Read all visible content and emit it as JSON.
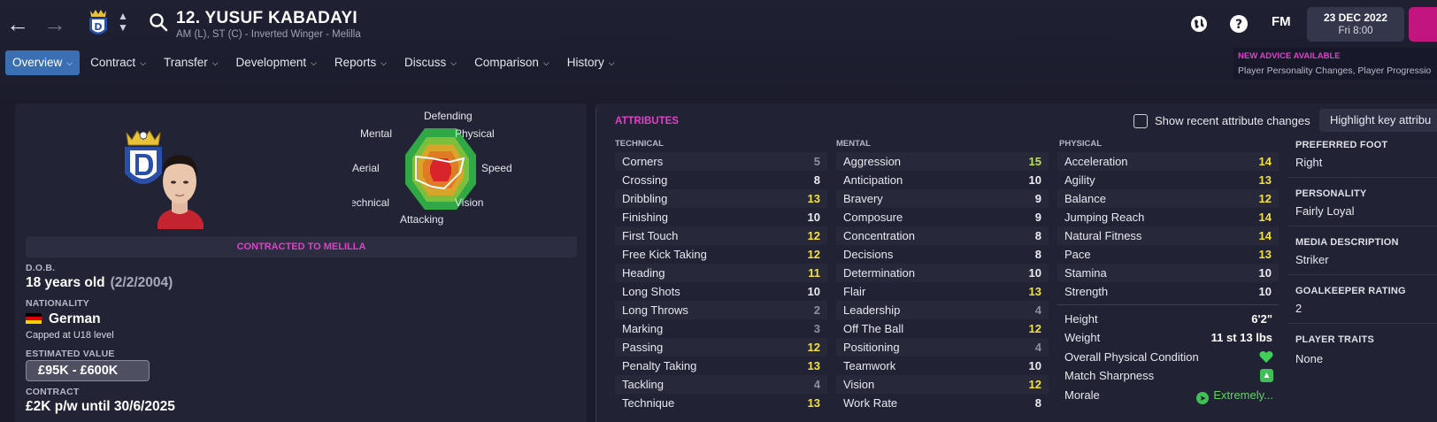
{
  "header": {
    "player_title": "12. YUSUF KABADAYI",
    "player_subtitle": "AM (L), ST (C) - Inverted Winger - Melilla",
    "fm_label": "FM",
    "date": "23 DEC 2022",
    "time": "Fri 8:00",
    "advice_title": "NEW ADVICE AVAILABLE",
    "advice_text": "Player Personality Changes, Player Progressio"
  },
  "tabs": [
    {
      "label": "Overview",
      "active": true
    },
    {
      "label": "Contract"
    },
    {
      "label": "Transfer"
    },
    {
      "label": "Development"
    },
    {
      "label": "Reports"
    },
    {
      "label": "Discuss"
    },
    {
      "label": "Comparison"
    },
    {
      "label": "History"
    }
  ],
  "radar": {
    "labels": [
      "Defending",
      "Physical",
      "Speed",
      "Vision",
      "Attacking",
      "Technical",
      "Aerial",
      "Mental"
    ]
  },
  "profile": {
    "contract_banner": "CONTRACTED TO MELILLA",
    "dob_label": "D.O.B.",
    "age": "18 years old",
    "dob": "(2/2/2004)",
    "nationality_label": "NATIONALITY",
    "nationality": "German",
    "caps": "Capped at U18 level",
    "value_label": "ESTIMATED VALUE",
    "value": "£95K - £600K",
    "contract_label": "CONTRACT",
    "contract": "£2K p/w until 30/6/2025"
  },
  "attributes": {
    "title": "ATTRIBUTES",
    "show_recent_label": "Show recent attribute changes",
    "highlight_label": "Highlight key attribu",
    "technical_label": "TECHNICAL",
    "mental_label": "MENTAL",
    "physical_label": "PHYSICAL",
    "technical": [
      {
        "name": "Corners",
        "value": "5"
      },
      {
        "name": "Crossing",
        "value": "8"
      },
      {
        "name": "Dribbling",
        "value": "13"
      },
      {
        "name": "Finishing",
        "value": "10"
      },
      {
        "name": "First Touch",
        "value": "12"
      },
      {
        "name": "Free Kick Taking",
        "value": "12"
      },
      {
        "name": "Heading",
        "value": "11"
      },
      {
        "name": "Long Shots",
        "value": "10"
      },
      {
        "name": "Long Throws",
        "value": "2"
      },
      {
        "name": "Marking",
        "value": "3"
      },
      {
        "name": "Passing",
        "value": "12"
      },
      {
        "name": "Penalty Taking",
        "value": "13"
      },
      {
        "name": "Tackling",
        "value": "4"
      },
      {
        "name": "Technique",
        "value": "13"
      }
    ],
    "mental": [
      {
        "name": "Aggression",
        "value": "15"
      },
      {
        "name": "Anticipation",
        "value": "10"
      },
      {
        "name": "Bravery",
        "value": "9"
      },
      {
        "name": "Composure",
        "value": "9"
      },
      {
        "name": "Concentration",
        "value": "8"
      },
      {
        "name": "Decisions",
        "value": "8"
      },
      {
        "name": "Determination",
        "value": "10"
      },
      {
        "name": "Flair",
        "value": "13"
      },
      {
        "name": "Leadership",
        "value": "4"
      },
      {
        "name": "Off The Ball",
        "value": "12"
      },
      {
        "name": "Positioning",
        "value": "4"
      },
      {
        "name": "Teamwork",
        "value": "10"
      },
      {
        "name": "Vision",
        "value": "12"
      },
      {
        "name": "Work Rate",
        "value": "8"
      }
    ],
    "physical": [
      {
        "name": "Acceleration",
        "value": "14"
      },
      {
        "name": "Agility",
        "value": "13"
      },
      {
        "name": "Balance",
        "value": "12"
      },
      {
        "name": "Jumping Reach",
        "value": "14"
      },
      {
        "name": "Natural Fitness",
        "value": "14"
      },
      {
        "name": "Pace",
        "value": "13"
      },
      {
        "name": "Stamina",
        "value": "10"
      },
      {
        "name": "Strength",
        "value": "10"
      }
    ]
  },
  "physical_info": {
    "height_label": "Height",
    "height": "6'2\"",
    "weight_label": "Weight",
    "weight": "11 st 13 lbs",
    "condition_label": "Overall Physical Condition",
    "sharpness_label": "Match Sharpness",
    "morale_label": "Morale",
    "morale": "Extremely..."
  },
  "side": {
    "foot_label": "PREFERRED FOOT",
    "foot": "Right",
    "personality_label": "PERSONALITY",
    "personality": "Fairly Loyal",
    "media_label": "MEDIA DESCRIPTION",
    "media": "Striker",
    "gk_label": "GOALKEEPER RATING",
    "gk": "2",
    "traits_label": "PLAYER TRAITS",
    "traits": "None"
  },
  "colors": {
    "accent_pink": "#e040c8",
    "tab_active": "#3a6fb3",
    "value_yellow": "#f2e23a",
    "value_green": "#b9e45a",
    "value_grey": "#8e8fa0"
  }
}
